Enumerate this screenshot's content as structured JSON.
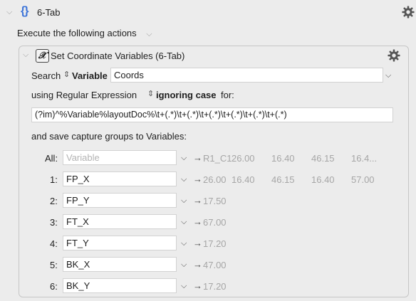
{
  "group": {
    "title": "6-Tab",
    "execute_label": "Execute the following actions"
  },
  "action": {
    "title": "Set Coordinate Variables (6-Tab)",
    "search_label": "Search",
    "search_type": "Variable",
    "variable_value": "Coords",
    "using_label": "using Regular Expression",
    "case_option": "ignoring case",
    "for_label": "for:",
    "regex": "(?im)^%Variable%layoutDoc%\\t+(.*)\\t+(.*)\\t+(.*)\\t+(.*)\\t+(.*)\\t+(.*)",
    "save_label": "and save capture groups to Variables:",
    "arrow": "→",
    "rows": [
      {
        "label": "All:",
        "variable": "",
        "placeholder": "Variable",
        "values": [
          "R1_C1",
          "26.00",
          "16.40",
          "46.15",
          "16.4..."
        ]
      },
      {
        "label": "1:",
        "variable": "FP_X",
        "placeholder": "",
        "values": [
          "26.00",
          "16.40",
          "46.15",
          "16.40",
          "57.00"
        ]
      },
      {
        "label": "2:",
        "variable": "FP_Y",
        "placeholder": "",
        "values": [
          "17.50"
        ]
      },
      {
        "label": "3:",
        "variable": "FT_X",
        "placeholder": "",
        "values": [
          "67.00"
        ]
      },
      {
        "label": "4:",
        "variable": "FT_Y",
        "placeholder": "",
        "values": [
          "17.20"
        ]
      },
      {
        "label": "5:",
        "variable": "BK_X",
        "placeholder": "",
        "values": [
          "47.00"
        ]
      },
      {
        "label": "6:",
        "variable": "BK_Y",
        "placeholder": "",
        "values": [
          "17.20"
        ]
      }
    ]
  },
  "colors": {
    "accent": "#3b73d8",
    "background": "#ececec",
    "muted_value": "#a6a6a6"
  },
  "icons": [
    "chevron-down-icon",
    "curly-braces-icon",
    "gear-icon",
    "variable-x-icon",
    "updown-arrows-icon",
    "right-arrow-icon"
  ]
}
